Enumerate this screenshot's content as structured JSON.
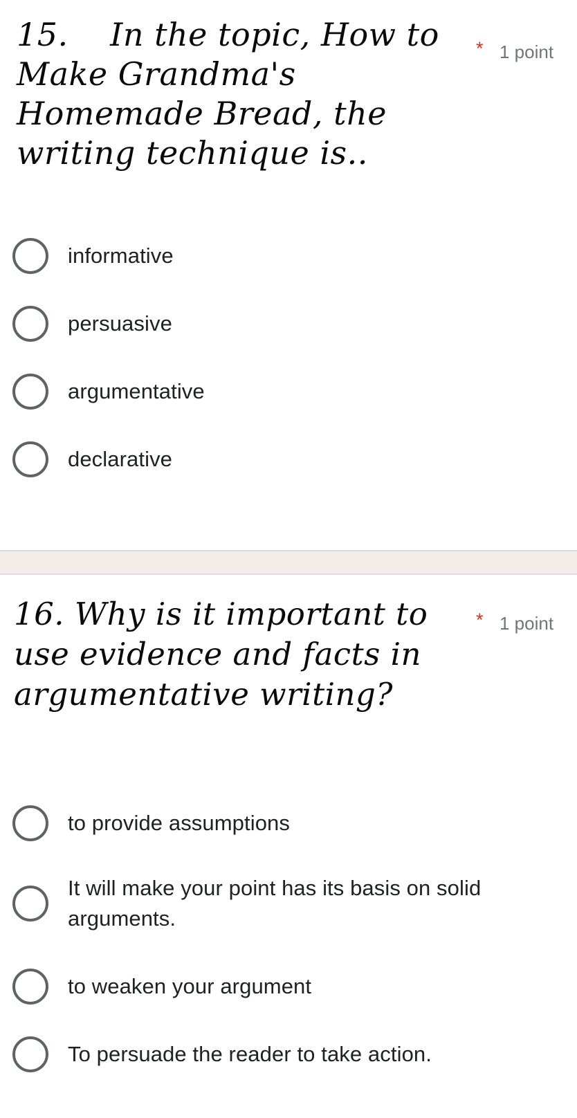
{
  "form": {
    "background_color": "#ffffff",
    "required_marker": "*",
    "required_color": "#d93025",
    "points_text_color": "#70757a",
    "radio_color": "#5f6368",
    "option_text_color": "#202124",
    "separator_color": "#f4ece8",
    "separator_border_color": "#dadce0"
  },
  "questions": [
    {
      "number": "15.",
      "text": "15.    In the topic, How to Make Grandma's Homemade Bread, the writing technique is..",
      "required_marker": "*",
      "points": "1 point",
      "options": [
        {
          "label": "informative",
          "selected": false
        },
        {
          "label": "persuasive",
          "selected": false
        },
        {
          "label": "argumentative",
          "selected": false
        },
        {
          "label": "declarative",
          "selected": false
        }
      ]
    },
    {
      "number": "16.",
      "text": "16. Why is it important to use evidence and facts in argumentative writing?",
      "required_marker": "*",
      "points": "1 point",
      "options": [
        {
          "label": "to provide assumptions",
          "selected": false
        },
        {
          "label": "It will make your point has its basis on solid arguments.",
          "selected": false
        },
        {
          "label": "to weaken your argument",
          "selected": false
        },
        {
          "label": "To persuade the reader to take action.",
          "selected": false
        }
      ]
    }
  ]
}
